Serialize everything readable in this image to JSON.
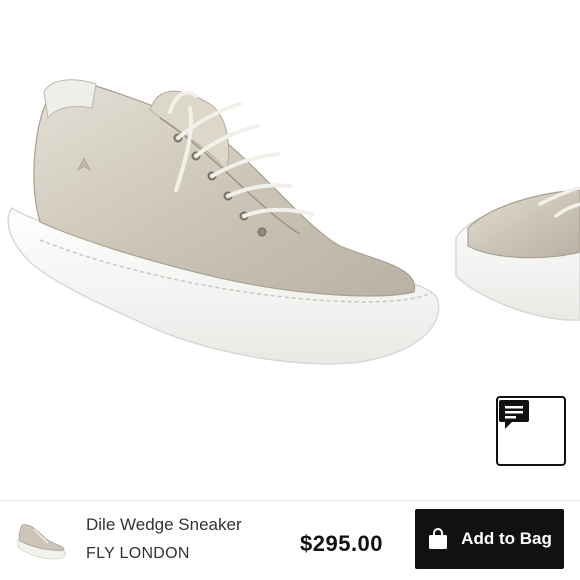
{
  "product": {
    "name": "Dile Wedge Sneaker",
    "brand": "FLY LONDON",
    "price": "$295.00",
    "image_alt": "Silver metallic leather lace-up wedge sneaker with white platform sole"
  },
  "actions": {
    "add_to_bag_label": "Add to Bag"
  },
  "icons": {
    "chat": "chat-icon",
    "bag": "shopping-bag-icon"
  },
  "colors": {
    "button_bg": "#111111",
    "button_text": "#ffffff",
    "shoe_upper": "#cfc9bd",
    "sole": "#f4f4f1"
  }
}
